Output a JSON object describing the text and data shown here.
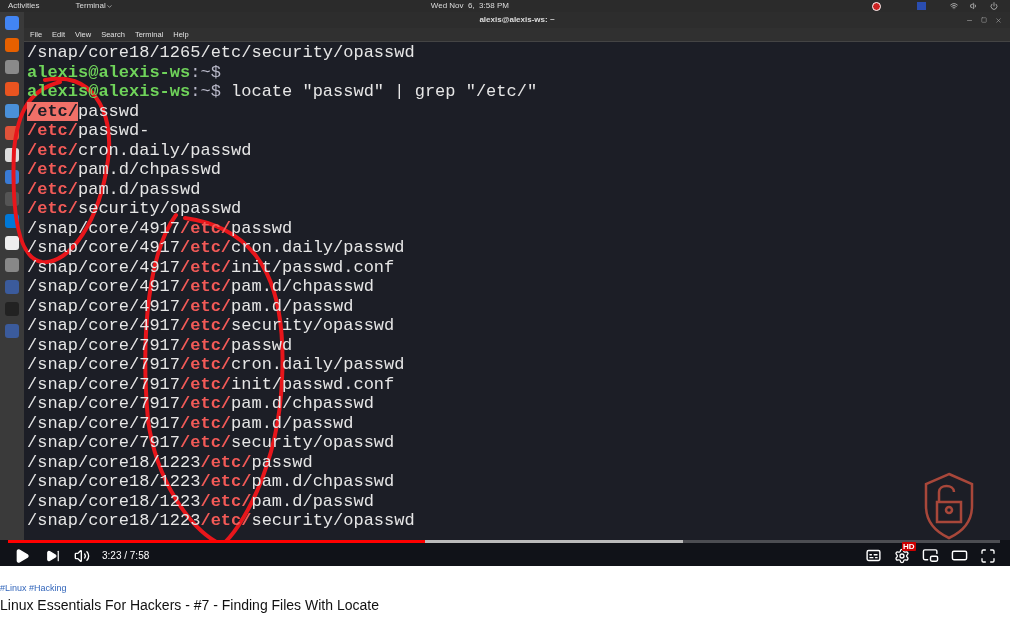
{
  "top_bar": {
    "activities": "Activities",
    "app_menu": "Terminal",
    "clock": "Wed Nov  6,  3:58 PM"
  },
  "terminal": {
    "title": "alexis@alexis-ws: ~",
    "menu": [
      "File",
      "Edit",
      "View",
      "Search",
      "Terminal",
      "Help"
    ],
    "lines": [
      [
        {
          "text": "/snap/core18/1265/etc/security/opasswd",
          "kind": "plain"
        }
      ],
      [
        {
          "text": "alexis@alexis-ws",
          "kind": "user"
        },
        {
          "text": ":~$",
          "kind": "path"
        }
      ],
      [
        {
          "text": "alexis@alexis-ws",
          "kind": "user"
        },
        {
          "text": ":~$",
          "kind": "path"
        },
        {
          "text": " locate \"passwd\" | grep \"/etc/\"",
          "kind": "plain"
        }
      ],
      [
        {
          "text": "/etc/",
          "kind": "highlight"
        },
        {
          "text": "passwd",
          "kind": "plain"
        }
      ],
      [
        {
          "text": "/etc/",
          "kind": "match"
        },
        {
          "text": "passwd-",
          "kind": "plain"
        }
      ],
      [
        {
          "text": "/etc/",
          "kind": "match"
        },
        {
          "text": "cron.daily/passwd",
          "kind": "plain"
        }
      ],
      [
        {
          "text": "/etc/",
          "kind": "match"
        },
        {
          "text": "pam.d/chpasswd",
          "kind": "plain"
        }
      ],
      [
        {
          "text": "/etc/",
          "kind": "match"
        },
        {
          "text": "pam.d/passwd",
          "kind": "plain"
        }
      ],
      [
        {
          "text": "/etc/",
          "kind": "match"
        },
        {
          "text": "security/opasswd",
          "kind": "plain"
        }
      ],
      [
        {
          "text": "/snap/core/4917",
          "kind": "plain"
        },
        {
          "text": "/etc/",
          "kind": "match"
        },
        {
          "text": "passwd",
          "kind": "plain"
        }
      ],
      [
        {
          "text": "/snap/core/4917",
          "kind": "plain"
        },
        {
          "text": "/etc/",
          "kind": "match"
        },
        {
          "text": "cron.daily/passwd",
          "kind": "plain"
        }
      ],
      [
        {
          "text": "/snap/core/4917",
          "kind": "plain"
        },
        {
          "text": "/etc/",
          "kind": "match"
        },
        {
          "text": "init/passwd.conf",
          "kind": "plain"
        }
      ],
      [
        {
          "text": "/snap/core/4917",
          "kind": "plain"
        },
        {
          "text": "/etc/",
          "kind": "match"
        },
        {
          "text": "pam.d/chpasswd",
          "kind": "plain"
        }
      ],
      [
        {
          "text": "/snap/core/4917",
          "kind": "plain"
        },
        {
          "text": "/etc/",
          "kind": "match"
        },
        {
          "text": "pam.d/passwd",
          "kind": "plain"
        }
      ],
      [
        {
          "text": "/snap/core/4917",
          "kind": "plain"
        },
        {
          "text": "/etc/",
          "kind": "match"
        },
        {
          "text": "security/opasswd",
          "kind": "plain"
        }
      ],
      [
        {
          "text": "/snap/core/7917",
          "kind": "plain"
        },
        {
          "text": "/etc/",
          "kind": "match"
        },
        {
          "text": "passwd",
          "kind": "plain"
        }
      ],
      [
        {
          "text": "/snap/core/7917",
          "kind": "plain"
        },
        {
          "text": "/etc/",
          "kind": "match"
        },
        {
          "text": "cron.daily/passwd",
          "kind": "plain"
        }
      ],
      [
        {
          "text": "/snap/core/7917",
          "kind": "plain"
        },
        {
          "text": "/etc/",
          "kind": "match"
        },
        {
          "text": "init/passwd.conf",
          "kind": "plain"
        }
      ],
      [
        {
          "text": "/snap/core/7917",
          "kind": "plain"
        },
        {
          "text": "/etc/",
          "kind": "match"
        },
        {
          "text": "pam.d/chpasswd",
          "kind": "plain"
        }
      ],
      [
        {
          "text": "/snap/core/7917",
          "kind": "plain"
        },
        {
          "text": "/etc/",
          "kind": "match"
        },
        {
          "text": "pam.d/passwd",
          "kind": "plain"
        }
      ],
      [
        {
          "text": "/snap/core/7917",
          "kind": "plain"
        },
        {
          "text": "/etc/",
          "kind": "match"
        },
        {
          "text": "security/opasswd",
          "kind": "plain"
        }
      ],
      [
        {
          "text": "/snap/core18/1223",
          "kind": "plain"
        },
        {
          "text": "/etc/",
          "kind": "match"
        },
        {
          "text": "passwd",
          "kind": "plain"
        }
      ],
      [
        {
          "text": "/snap/core18/1223",
          "kind": "plain"
        },
        {
          "text": "/etc/",
          "kind": "match"
        },
        {
          "text": "pam.d/chpasswd",
          "kind": "plain"
        }
      ],
      [
        {
          "text": "/snap/core18/1223",
          "kind": "plain"
        },
        {
          "text": "/etc/",
          "kind": "match"
        },
        {
          "text": "pam.d/passwd",
          "kind": "plain"
        }
      ],
      [
        {
          "text": "/snap/core18/1223",
          "kind": "plain"
        },
        {
          "text": "/etc/",
          "kind": "match"
        },
        {
          "text": "security/opasswd",
          "kind": "plain"
        }
      ]
    ]
  },
  "player": {
    "progress": {
      "level": 0.42
    },
    "buffer": {
      "level": 0.68
    },
    "time": "3:23 / 7:58",
    "quality_badge": "HD"
  },
  "video_info": {
    "hashtags": "#Linux #Hacking",
    "title": "Linux Essentials For Hackers - #7 - Finding Files With Locate"
  }
}
